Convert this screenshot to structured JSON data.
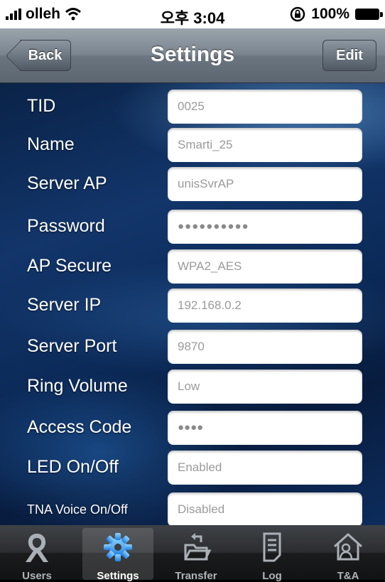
{
  "status": {
    "carrier": "olleh",
    "time": "오후 3:04",
    "battery": "100%"
  },
  "nav": {
    "title": "Settings",
    "back_label": "Back",
    "edit_label": "Edit"
  },
  "rows": [
    {
      "label": "TID",
      "value": "0025"
    },
    {
      "label": "Name",
      "value": "Smarti_25"
    },
    {
      "label": "Server AP",
      "value": "unisSvrAP"
    },
    {
      "label": "Password",
      "value": "●●●●●●●●●●"
    },
    {
      "label": "AP Secure",
      "value": "WPA2_AES"
    },
    {
      "label": "Server IP",
      "value": "192.168.0.2"
    },
    {
      "label": "Server Port",
      "value": "9870"
    },
    {
      "label": "Ring Volume",
      "value": "Low"
    },
    {
      "label": "Access Code",
      "value": "●●●●"
    },
    {
      "label": "LED On/Off",
      "value": "Enabled"
    },
    {
      "label": "TNA Voice On/Off",
      "value": "Disabled"
    }
  ],
  "tabs": [
    {
      "label": "Users",
      "icon": "user-icon"
    },
    {
      "label": "Settings",
      "icon": "gear-icon",
      "active": true
    },
    {
      "label": "Transfer",
      "icon": "folder-transfer-icon"
    },
    {
      "label": "Log",
      "icon": "document-icon"
    },
    {
      "label": "T&A",
      "icon": "home-user-icon"
    }
  ]
}
